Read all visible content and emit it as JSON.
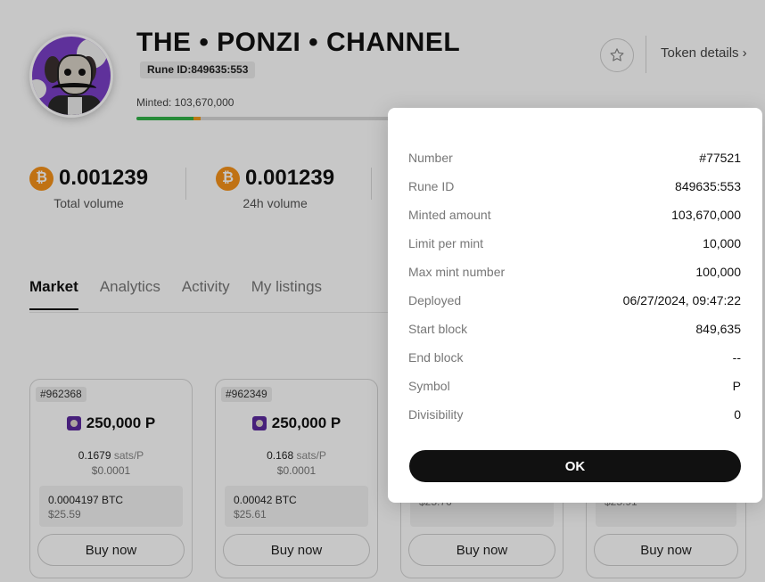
{
  "header": {
    "title": "THE • PONZI • CHANNEL",
    "rune_id_badge": "Rune ID:849635:553",
    "minted_label": "Minted: 103,670,000",
    "token_details": "Token details",
    "minted_progress_percent": 22
  },
  "stats": [
    {
      "value": "0.001239",
      "label": "Total volume"
    },
    {
      "value": "0.001239",
      "label": "24h volume"
    }
  ],
  "tabs": [
    {
      "label": "Market",
      "active": true
    },
    {
      "label": "Analytics",
      "active": false
    },
    {
      "label": "Activity",
      "active": false
    },
    {
      "label": "My listings",
      "active": false
    }
  ],
  "listings": [
    {
      "number": "#962368",
      "amount": "250,000 P",
      "price": "0.1679",
      "unit": "sats/P",
      "unit_usd": "$0.0001",
      "total_btc": "0.0004197 BTC",
      "total_usd": "$25.59",
      "buy_label": "Buy now"
    },
    {
      "number": "#962349",
      "amount": "250,000 P",
      "price": "0.168",
      "unit": "sats/P",
      "unit_usd": "$0.0001",
      "total_btc": "0.00042 BTC",
      "total_usd": "$25.61",
      "buy_label": "Buy now"
    },
    {
      "total_usd": "$25.76",
      "buy_label": "Buy now"
    },
    {
      "total_usd": "$25.91",
      "buy_label": "Buy now"
    }
  ],
  "modal": {
    "rows": [
      {
        "key": "Number",
        "value": "#77521"
      },
      {
        "key": "Rune ID",
        "value": "849635:553"
      },
      {
        "key": "Minted amount",
        "value": "103,670,000"
      },
      {
        "key": "Limit per mint",
        "value": "10,000"
      },
      {
        "key": "Max mint number",
        "value": "100,000"
      },
      {
        "key": "Deployed",
        "value": "06/27/2024, 09:47:22"
      },
      {
        "key": "Start block",
        "value": "849,635"
      },
      {
        "key": "End block",
        "value": "--"
      },
      {
        "key": "Symbol",
        "value": "P"
      },
      {
        "key": "Divisibility",
        "value": "0"
      }
    ],
    "ok_label": "OK"
  },
  "colors": {
    "btc": "#f7931a",
    "progress_minted": "#32b24a",
    "progress_pending": "#f39a1d",
    "ok_button": "#111111"
  },
  "icons": [
    "star-icon",
    "chevron-right-icon",
    "bitcoin-icon",
    "rune-token-icon"
  ]
}
